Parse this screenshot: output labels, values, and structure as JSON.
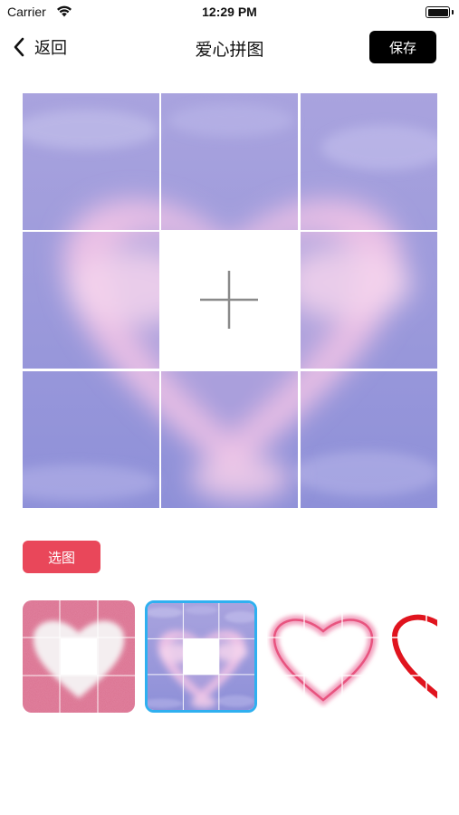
{
  "status_bar": {
    "carrier": "Carrier",
    "time": "12:29 PM",
    "icons": [
      "wifi-icon",
      "battery-icon"
    ]
  },
  "nav": {
    "back_label": "返回",
    "title": "爱心拼图",
    "save_label": "保存"
  },
  "puzzle": {
    "rows": 3,
    "cols": 3,
    "empty_cell": 4,
    "empty_icon": "plus-icon"
  },
  "actions": {
    "pick_image_label": "选图"
  },
  "templates": {
    "selected_index": 1,
    "items": [
      "sand-heart-template",
      "cloud-heart-template",
      "pink-outline-heart-template",
      "red-heart-template"
    ]
  },
  "colors": {
    "save_button": "#000000",
    "pick_button": "#e9475a",
    "selected_border": "#2fb0f0"
  }
}
